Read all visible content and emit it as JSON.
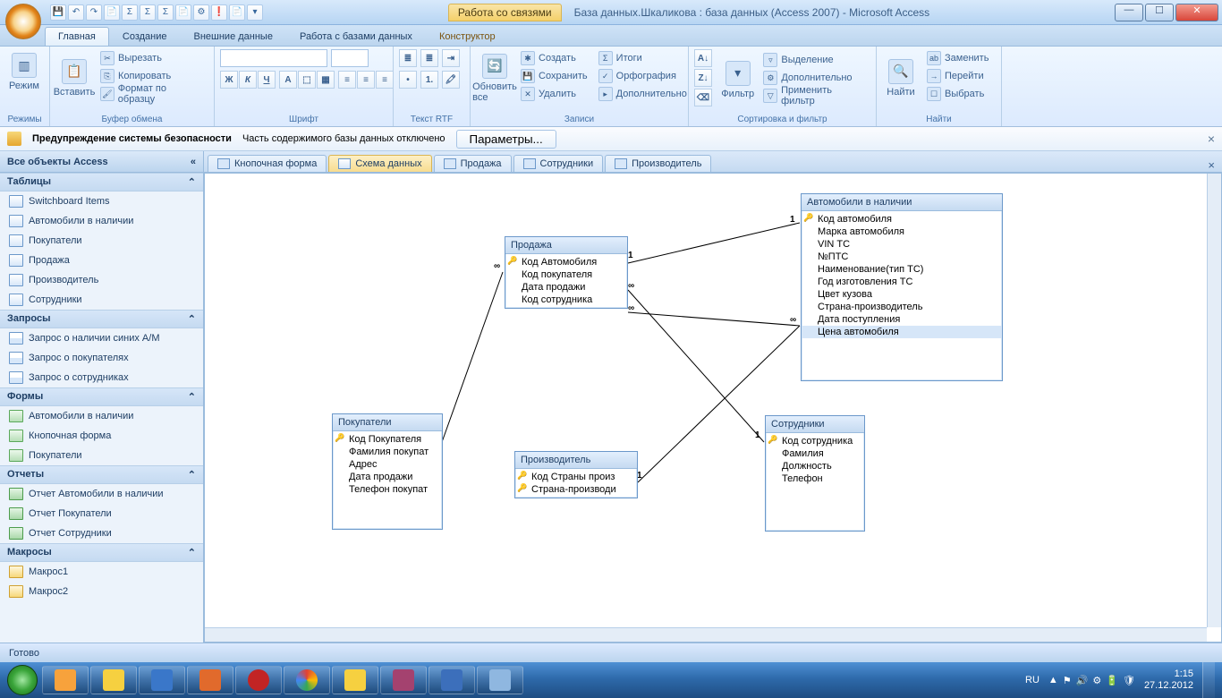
{
  "title": {
    "tool_tab": "Работа со связями",
    "doc": "База данных.Шкаликова : база данных (Access 2007) - Microsoft Access"
  },
  "ribbon_tabs": [
    "Главная",
    "Создание",
    "Внешние данные",
    "Работа с базами данных",
    "Конструктор"
  ],
  "ribbon": {
    "g1": "Режимы",
    "g1_btn": "Режим",
    "g2": "Буфер обмена",
    "g2_btn": "Вставить",
    "g2_cut": "Вырезать",
    "g2_copy": "Копировать",
    "g2_fmt": "Формат по образцу",
    "g3": "Шрифт",
    "g4": "Текст RTF",
    "g5": "Записи",
    "g5_btn": "Обновить все",
    "g5_new": "Создать",
    "g5_save": "Сохранить",
    "g5_del": "Удалить",
    "g5_tot": "Итоги",
    "g5_spl": "Орфография",
    "g5_more": "Дополнительно",
    "g6": "Сортировка и фильтр",
    "g6_btn": "Фильтр",
    "g6_sel": "Выделение",
    "g6_adv": "Дополнительно",
    "g6_tog": "Применить фильтр",
    "g7": "Найти",
    "g7_btn": "Найти",
    "g7_rep": "Заменить",
    "g7_go": "Перейти",
    "g7_sel": "Выбрать"
  },
  "security": {
    "title": "Предупреждение системы безопасности",
    "msg": "Часть содержимого базы данных отключено",
    "btn": "Параметры..."
  },
  "nav": {
    "header": "Все объекты Access",
    "cats": {
      "tables": "Таблицы",
      "queries": "Запросы",
      "forms": "Формы",
      "reports": "Отчеты",
      "macros": "Макросы"
    },
    "tables": [
      "Switchboard Items",
      "Автомобили в наличии",
      "Покупатели",
      "Продажа",
      "Производитель",
      "Сотрудники"
    ],
    "queries": [
      "Запрос о наличии синих А/М",
      "Запрос о покупателях",
      "Запрос о сотрудниках"
    ],
    "forms": [
      "Автомобили в наличии",
      "Кнопочная форма",
      "Покупатели"
    ],
    "reports": [
      "Отчет Автомобили в наличии",
      "Отчет Покупатели",
      "Отчет Сотрудники"
    ],
    "macros": [
      "Макрос1",
      "Макрос2"
    ]
  },
  "doc_tabs": [
    "Кнопочная форма",
    "Схема данных",
    "Продажа",
    "Сотрудники",
    "Производитель"
  ],
  "tables_diag": {
    "prodazha": {
      "title": "Продажа",
      "fields": [
        "Код Автомобиля",
        "Код покупателя",
        "Дата продажи",
        "Код сотрудника"
      ],
      "key": [
        0
      ]
    },
    "avto": {
      "title": "Автомобили в наличии",
      "fields": [
        "Код автомобиля",
        "Марка автомобиля",
        "VIN ТС",
        "№ПТС",
        "Наименование(тип ТС)",
        "Год изготовления ТС",
        "Цвет кузова",
        "Страна-производитель",
        "Дата поступления",
        "Цена автомобиля"
      ],
      "key": [
        0
      ],
      "sel": 9
    },
    "pokup": {
      "title": "Покупатели",
      "fields": [
        "Код Покупателя",
        "Фамилия покупат",
        "Адрес",
        "Дата продажи",
        "Телефон покупат"
      ],
      "key": [
        0
      ]
    },
    "proizv": {
      "title": "Производитель",
      "fields": [
        "Код Страны произ",
        "Страна-производи"
      ],
      "key": [
        0,
        1
      ]
    },
    "sotr": {
      "title": "Сотрудники",
      "fields": [
        "Код сотрудника",
        "Фамилия",
        "Должность",
        "Телефон"
      ],
      "key": [
        0
      ]
    }
  },
  "status": "Готово",
  "tray": {
    "lang": "RU",
    "time": "1:15",
    "date": "27.12.2012"
  }
}
